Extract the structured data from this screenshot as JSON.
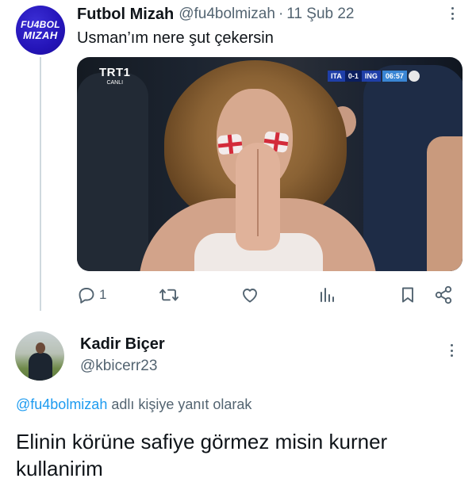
{
  "tweet": {
    "avatar_line1": "FU4BOL",
    "avatar_line2": "MIZAH",
    "author_name": "Futbol Mizah",
    "author_handle": "@fu4bolmizah",
    "separator": "·",
    "date": "11 Şub 22",
    "text": "Usman’ım nere şut çekersin",
    "media": {
      "channel_logo": "TRT1",
      "channel_sub": "CANLI",
      "score_team1": "ITA",
      "score": "0-1",
      "score_team2": "ING",
      "match_time": "06:57"
    },
    "actions": {
      "reply_icon": "reply-icon",
      "reply_count": "1",
      "retweet_icon": "retweet-icon",
      "like_icon": "heart-icon",
      "views_icon": "views-chart-icon",
      "bookmark_icon": "bookmark-icon",
      "share_icon": "share-icon"
    }
  },
  "reply": {
    "author_name": "Kadir Biçer",
    "author_handle": "@kbicerr23",
    "replying_to_handle": "@fu4bolmizah",
    "replying_to_suffix": " adlı kişiye yanıt olarak",
    "text": "Elinin körüne safiye görmez misin kurner kullanirim"
  },
  "colors": {
    "text_primary": "#0f1419",
    "text_secondary": "#536471",
    "link": "#1d9bf0",
    "thread_line": "#cfd9de"
  }
}
